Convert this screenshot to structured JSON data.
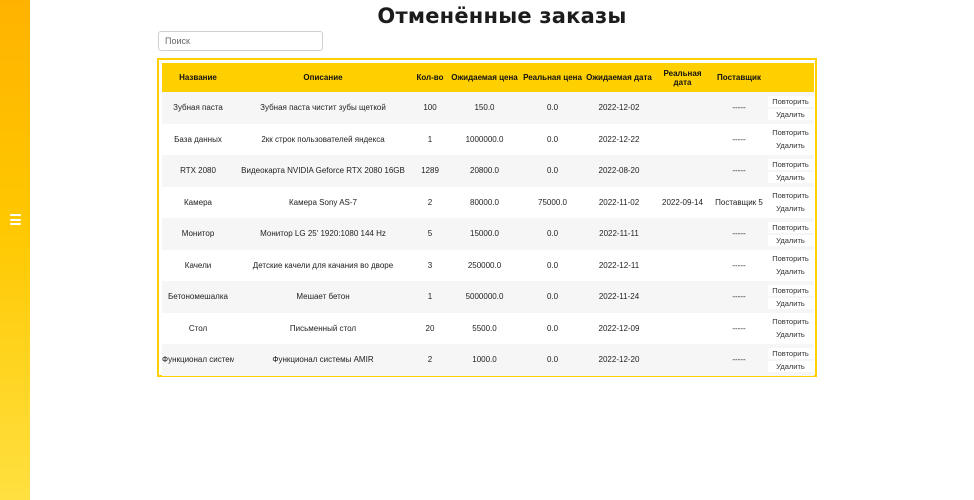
{
  "page": {
    "title": "Отменённые заказы"
  },
  "search": {
    "placeholder": "Поиск"
  },
  "table": {
    "columns": [
      "Название",
      "Описание",
      "Кол-во",
      "Ожидаемая цена",
      "Реальная цена",
      "Ожидаемая дата",
      "Реальная дата",
      "Поставщик",
      ""
    ],
    "rows": [
      {
        "name": "Зубная паста",
        "description": "Зубная паста чистит зубы щеткой",
        "qty": "100",
        "expected_price": "150.0",
        "real_price": "0.0",
        "expected_date": "2022-12-02",
        "real_date": "",
        "supplier": "-----",
        "repeat": "Повторить",
        "delete": "Удалить"
      },
      {
        "name": "База данных",
        "description": "2кк строк пользователей яндекса",
        "qty": "1",
        "expected_price": "1000000.0",
        "real_price": "0.0",
        "expected_date": "2022-12-22",
        "real_date": "",
        "supplier": "-----",
        "repeat": "Повторить",
        "delete": "Удалить"
      },
      {
        "name": "RTX 2080",
        "description": "Видеокарта NVIDIA Geforce RTX 2080 16GB",
        "qty": "1289",
        "expected_price": "20800.0",
        "real_price": "0.0",
        "expected_date": "2022-08-20",
        "real_date": "",
        "supplier": "-----",
        "repeat": "Повторить",
        "delete": "Удалить"
      },
      {
        "name": "Камера",
        "description": "Камера Sony AS-7",
        "qty": "2",
        "expected_price": "80000.0",
        "real_price": "75000.0",
        "expected_date": "2022-11-02",
        "real_date": "2022-09-14",
        "supplier": "Поставщик 5",
        "repeat": "Повторить",
        "delete": "Удалить"
      },
      {
        "name": "Монитор",
        "description": "Монитор LG 25' 1920:1080 144 Hz",
        "qty": "5",
        "expected_price": "15000.0",
        "real_price": "0.0",
        "expected_date": "2022-11-11",
        "real_date": "",
        "supplier": "-----",
        "repeat": "Повторить",
        "delete": "Удалить"
      },
      {
        "name": "Качели",
        "description": "Детские качели для качания во дворе",
        "qty": "3",
        "expected_price": "250000.0",
        "real_price": "0.0",
        "expected_date": "2022-12-11",
        "real_date": "",
        "supplier": "-----",
        "repeat": "Повторить",
        "delete": "Удалить"
      },
      {
        "name": "Бетономешалка",
        "description": "Мешает бетон",
        "qty": "1",
        "expected_price": "5000000.0",
        "real_price": "0.0",
        "expected_date": "2022-11-24",
        "real_date": "",
        "supplier": "-----",
        "repeat": "Повторить",
        "delete": "Удалить"
      },
      {
        "name": "Стол",
        "description": "Письменный стол",
        "qty": "20",
        "expected_price": "5500.0",
        "real_price": "0.0",
        "expected_date": "2022-12-09",
        "real_date": "",
        "supplier": "-----",
        "repeat": "Повторить",
        "delete": "Удалить"
      },
      {
        "name": "Функционал системы",
        "description": "Функционал системы AMIR",
        "qty": "2",
        "expected_price": "1000.0",
        "real_price": "0.0",
        "expected_date": "2022-12-20",
        "real_date": "",
        "supplier": "-----",
        "repeat": "Повторить",
        "delete": "Удалить"
      }
    ]
  },
  "icons": {
    "menu": "hamburger-menu-icon"
  },
  "colors": {
    "accent": "#ffd000",
    "sidebar_top": "#ffb300",
    "sidebar_bottom": "#ffe040"
  }
}
